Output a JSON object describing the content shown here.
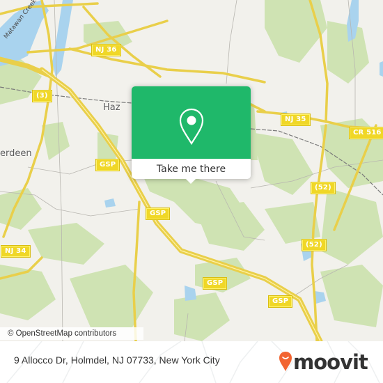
{
  "map": {
    "popup": {
      "cta_label": "Take me there",
      "icon": "map-pin-icon",
      "accent_color": "#1fb86a"
    },
    "places": {
      "hazlet": "Haz",
      "aberdeen": "erdeen",
      "matawan_creek": "Matawan Creek"
    },
    "shields": {
      "nj36": "NJ 36",
      "route3": "(3)",
      "gsp1": "GSP",
      "gsp2": "GSP",
      "gsp3": "GSP",
      "gsp4": "GSP",
      "nj35": "NJ 35",
      "cr516": "CR 516",
      "route52a": "(52)",
      "route52b": "(52)",
      "nj34": "NJ 34"
    },
    "attribution": "© OpenStreetMap contributors"
  },
  "footer": {
    "address": "9 Allocco Dr, Holmdel, NJ 07733, New York City",
    "brand": "moovit",
    "brand_color": "#f26430"
  }
}
